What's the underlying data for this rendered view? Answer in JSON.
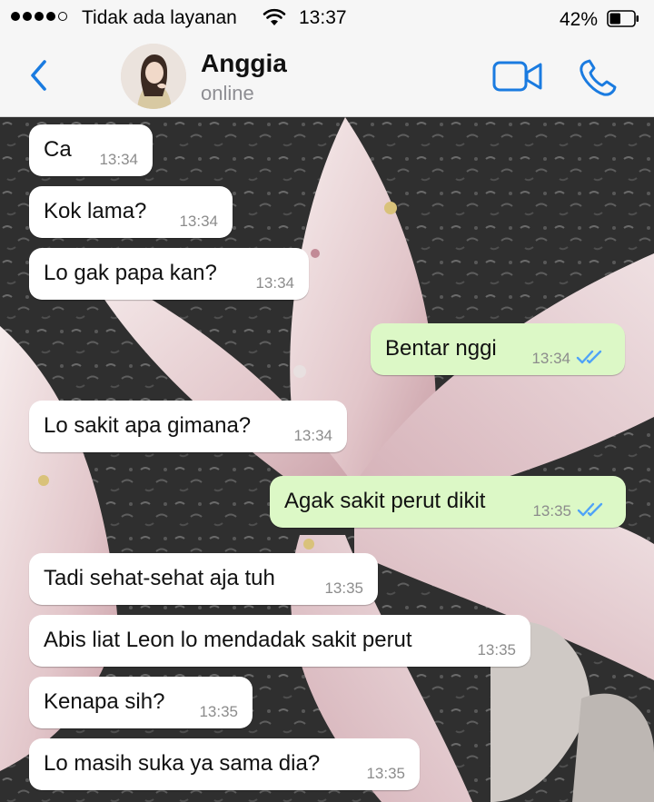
{
  "status_bar": {
    "carrier": "Tidak ada layanan",
    "time": "13:37",
    "battery": "42%"
  },
  "header": {
    "contact_name": "Anggia",
    "contact_status": "online",
    "icons": [
      "chevron-left-icon",
      "avatar",
      "video-camera-icon",
      "phone-icon"
    ],
    "accent_color": "#1a7be0"
  },
  "messages": [
    {
      "dir": "in",
      "text": "Ca",
      "time": "13:34"
    },
    {
      "dir": "in",
      "text": "Kok lama?",
      "time": "13:34"
    },
    {
      "dir": "in",
      "text": "Lo gak papa kan?",
      "time": "13:34"
    },
    {
      "dir": "out",
      "text": "Bentar nggi",
      "time": "13:34",
      "read": true
    },
    {
      "dir": "in",
      "text": "Lo sakit apa gimana?",
      "time": "13:34"
    },
    {
      "dir": "out",
      "text": "Agak sakit perut dikit",
      "time": "13:35",
      "read": true
    },
    {
      "dir": "in",
      "text": "Tadi sehat-sehat aja tuh",
      "time": "13:35"
    },
    {
      "dir": "in",
      "text": "Abis liat Leon lo mendadak sakit perut",
      "time": "13:35"
    },
    {
      "dir": "in",
      "text": "Kenapa sih?",
      "time": "13:35"
    },
    {
      "dir": "in",
      "text": "Lo masih suka ya sama dia?",
      "time": "13:35"
    }
  ],
  "colors": {
    "incoming_bubble": "#ffffff",
    "outgoing_bubble": "#dcf8c6",
    "read_ticks": "#4fa3f7"
  }
}
